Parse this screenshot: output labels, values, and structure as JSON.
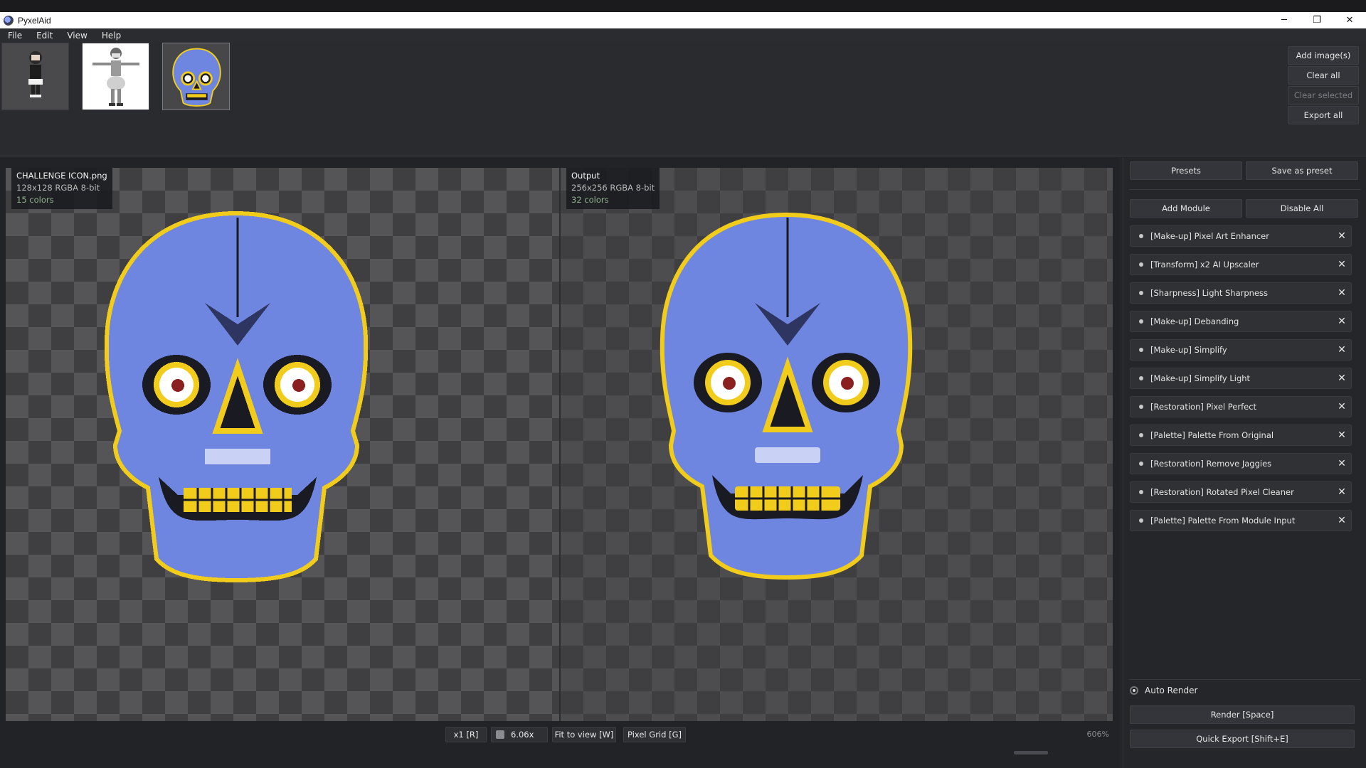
{
  "app": {
    "title": "PyxelAid"
  },
  "window_controls": {
    "minimize": "─",
    "maximize": "❐",
    "close": "✕"
  },
  "menu": [
    "File",
    "Edit",
    "View",
    "Help"
  ],
  "toolbar": {
    "add_images": "Add image(s)",
    "clear_all": "Clear all",
    "clear_selected": "Clear selected",
    "export_all": "Export all"
  },
  "input_info": {
    "filename": "CHALLENGE ICON.png",
    "meta": "128x128  RGBA  8-bit",
    "colors": "15 colors"
  },
  "output_info": {
    "title": "Output",
    "meta": "256x256  RGBA  8-bit",
    "colors": "32 colors"
  },
  "zoom": {
    "x1": "x1 [R]",
    "value": "6.06x",
    "fit": "Fit to view [W]",
    "grid": "Pixel Grid [G]",
    "percent": "606%"
  },
  "panel": {
    "presets": "Presets",
    "save_preset": "Save as preset",
    "add_module": "Add Module",
    "disable_all": "Disable All",
    "modules": [
      "[Make-up] Pixel Art Enhancer",
      "[Transform] x2 AI Upscaler",
      "[Sharpness] Light Sharpness",
      "[Make-up] Debanding",
      "[Make-up] Simplify",
      "[Make-up] Simplify Light",
      "[Restoration] Pixel Perfect",
      "[Palette] Palette From Original",
      "[Restoration] Remove Jaggies",
      "[Restoration] Rotated Pixel Cleaner",
      "[Palette] Palette From Module Input"
    ],
    "auto_render": "Auto Render",
    "render": "Render  [Space]",
    "quick_export": "Quick Export  [Shift+E]"
  },
  "colors": {
    "skull_blue": "#6f86e0",
    "skull_yellow": "#f2cc1a",
    "dark": "#1a1a22"
  }
}
